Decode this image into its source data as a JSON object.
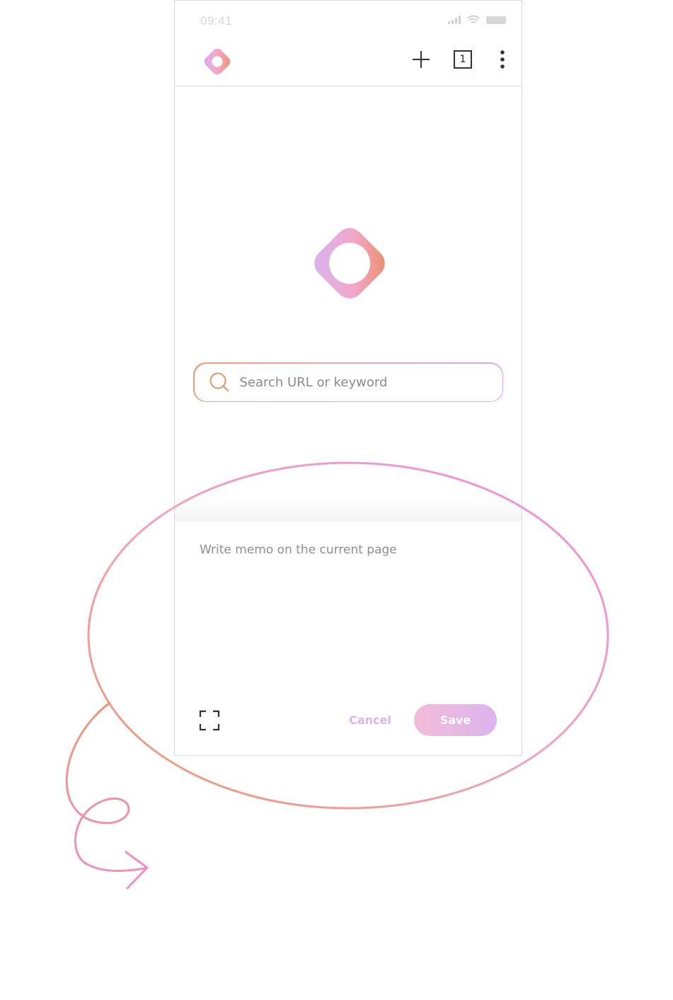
{
  "status_bar": {
    "time": "09:41"
  },
  "toolbar": {
    "tab_count": "1",
    "icons": [
      "app-logo-icon",
      "plus-icon",
      "tab-counter-icon",
      "more-vertical-icon"
    ]
  },
  "search": {
    "placeholder": "Search URL or keyword",
    "value": ""
  },
  "memo": {
    "placeholder": "Write memo on the current page",
    "value": "",
    "cancel_label": "Cancel",
    "save_label": "Save"
  },
  "colors": {
    "gradient_orange": "#ee9b76",
    "gradient_pink": "#f3a7c4",
    "gradient_purple": "#dcaef2",
    "annotation_pink": "#f08fc0",
    "annotation_orange": "#ea9a74"
  }
}
